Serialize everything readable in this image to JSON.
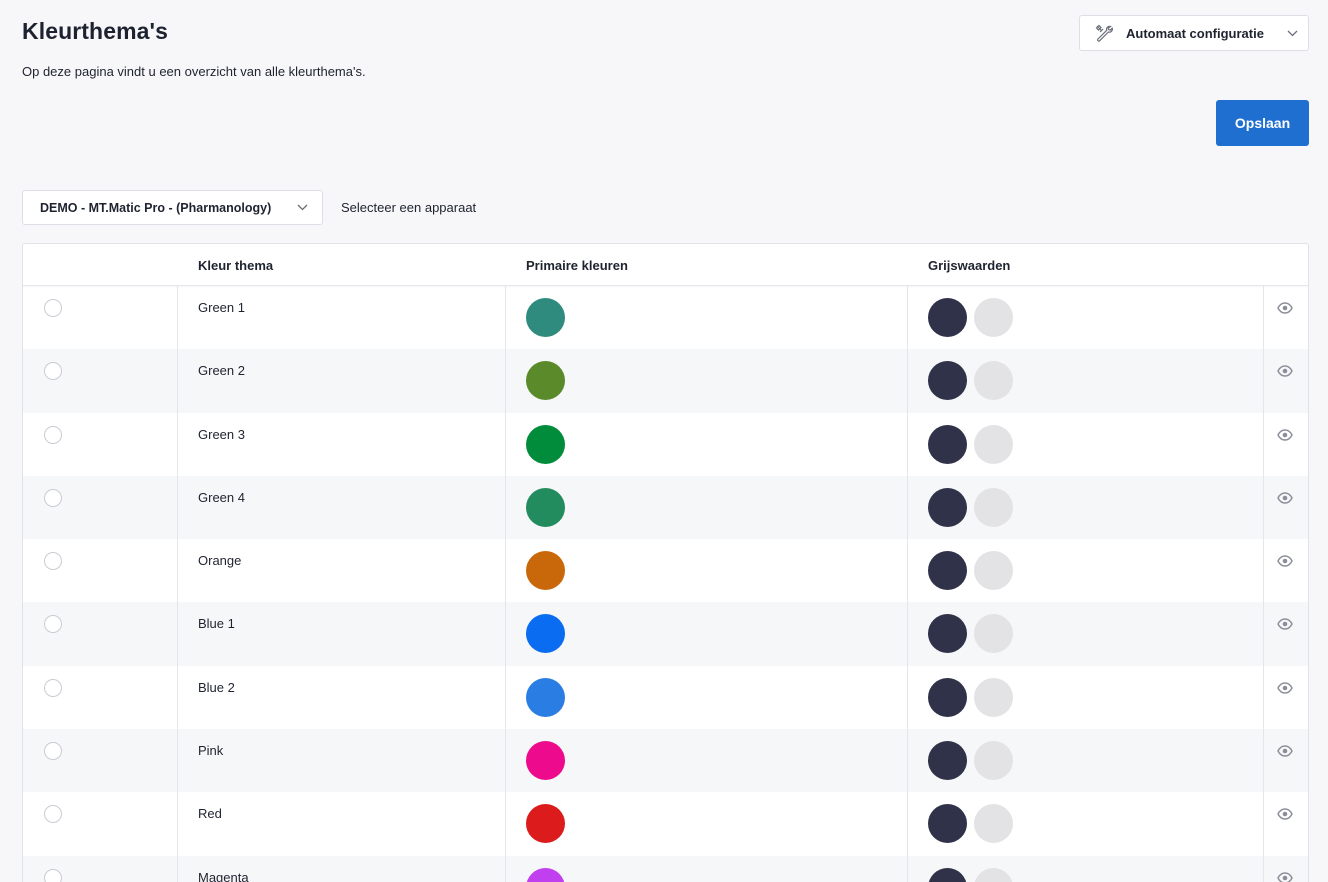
{
  "header": {
    "title": "Kleurthema's",
    "subtitle": "Op deze pagina vindt u een overzicht van alle kleurthema's.",
    "config_dropdown": {
      "label": "Automaat configuratie",
      "icon": "tools-icon"
    },
    "save_label": "Opslaan"
  },
  "device": {
    "selected": "DEMO - MT.Matic Pro - (Pharmanology)",
    "hint": "Selecteer een apparaat"
  },
  "table": {
    "columns": [
      "",
      "Kleur thema",
      "Primaire kleuren",
      "Grijswaarden"
    ],
    "rows": [
      {
        "name": "Green 1",
        "primary": "#2e8b7e"
      },
      {
        "name": "Green 2",
        "primary": "#5a8a2a"
      },
      {
        "name": "Green 3",
        "primary": "#008c3a"
      },
      {
        "name": "Green 4",
        "primary": "#238c5e"
      },
      {
        "name": "Orange",
        "primary": "#c8680a"
      },
      {
        "name": "Blue 1",
        "primary": "#0a6cf0"
      },
      {
        "name": "Blue 2",
        "primary": "#2a7de3"
      },
      {
        "name": "Pink",
        "primary": "#ee0a8c"
      },
      {
        "name": "Red",
        "primary": "#dc1c1c"
      },
      {
        "name": "Magenta",
        "primary": "#c040f0"
      }
    ],
    "gray_values": [
      "#2f3248",
      "#e3e3e5"
    ]
  },
  "colors": {
    "accent": "#1f6fd0",
    "background": "#f7f7f9"
  }
}
